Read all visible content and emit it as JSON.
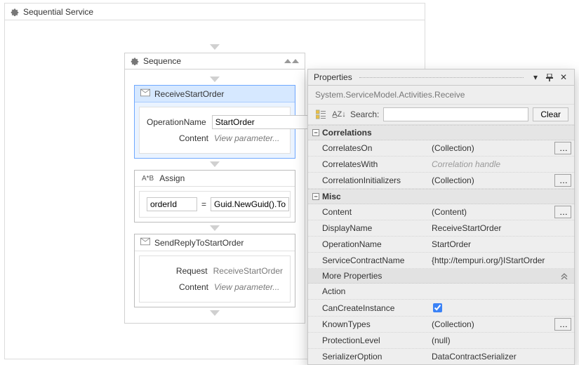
{
  "designer": {
    "outer_title": "Sequential Service",
    "sequence_title": "Sequence"
  },
  "receive": {
    "title": "ReceiveStartOrder",
    "op_label": "OperationName",
    "op_value": "StartOrder",
    "content_label": "Content",
    "content_link": "View parameter..."
  },
  "assign": {
    "title": "Assign",
    "lhs": "orderId",
    "eq": "=",
    "rhs": "Guid.NewGuid().To"
  },
  "reply": {
    "title": "SendReplyToStartOrder",
    "request_label": "Request",
    "request_value": "ReceiveStartOrder",
    "content_label": "Content",
    "content_link": "View parameter..."
  },
  "props": {
    "panel_title": "Properties",
    "type_line": "System.ServiceModel.Activities.Receive",
    "search_label": "Search:",
    "search_placeholder": "",
    "clear_label": "Clear",
    "cat_correlations": "Correlations",
    "cat_misc": "Misc",
    "correlations": {
      "CorrelatesOn_label": "CorrelatesOn",
      "CorrelatesOn_value": "(Collection)",
      "CorrelatesWith_label": "CorrelatesWith",
      "CorrelatesWith_value": "Correlation handle",
      "CorrelationInitializers_label": "CorrelationInitializers",
      "CorrelationInitializers_value": "(Collection)"
    },
    "misc": {
      "Content_label": "Content",
      "Content_value": "(Content)",
      "DisplayName_label": "DisplayName",
      "DisplayName_value": "ReceiveStartOrder",
      "OperationName_label": "OperationName",
      "OperationName_value": "StartOrder",
      "ServiceContractName_label": "ServiceContractName",
      "ServiceContractName_value": "{http://tempuri.org/}IStartOrder",
      "more_label": "More Properties",
      "Action_label": "Action",
      "Action_value": "",
      "CanCreateInstance_label": "CanCreateInstance",
      "CanCreateInstance_checked": true,
      "KnownTypes_label": "KnownTypes",
      "KnownTypes_value": "(Collection)",
      "ProtectionLevel_label": "ProtectionLevel",
      "ProtectionLevel_value": "(null)",
      "SerializerOption_label": "SerializerOption",
      "SerializerOption_value": "DataContractSerializer"
    }
  }
}
